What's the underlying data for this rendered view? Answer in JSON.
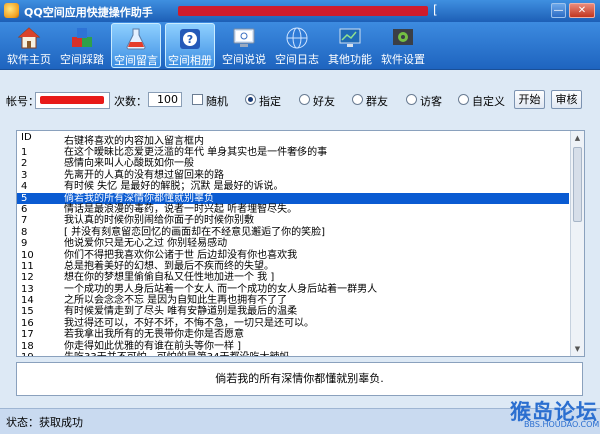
{
  "window": {
    "title": "QQ空间应用快捷操作助手",
    "title_bracket": "[",
    "title_suffix_redacted": "",
    "min_glyph": "—",
    "close_glyph": "✕"
  },
  "toolbar": [
    {
      "label": "软件主页",
      "icon": "house-icon"
    },
    {
      "label": "空间踩踏",
      "icon": "cubes-icon"
    },
    {
      "label": "空间留言",
      "icon": "flask-icon",
      "active": true
    },
    {
      "label": "空间相册",
      "icon": "help-icon",
      "active": true
    },
    {
      "label": "空间说说",
      "icon": "monitor-icon"
    },
    {
      "label": "空间日志",
      "icon": "globe-icon"
    },
    {
      "label": "其他功能",
      "icon": "desktop-icon"
    },
    {
      "label": "软件设置",
      "icon": "gear-icon"
    }
  ],
  "controls": {
    "account_label": "帐号：",
    "account_value": "",
    "times_label": "次数：",
    "times_value": "100",
    "random_label": "随机",
    "radio_specified": "指定",
    "radio_friends": "好友",
    "radio_groups": "群友",
    "radio_visitors": "访客",
    "radio_custom": "自定义",
    "start_button": "开始",
    "review_button": "审核"
  },
  "list": {
    "columns": [
      "ID",
      "右键将喜欢的内容加入留言框内"
    ],
    "selected_index": 4,
    "rows": [
      {
        "id": "1",
        "text": "在这个暧昧比恋爱更泛滥的年代  单身其实也是一件奢侈的事"
      },
      {
        "id": "2",
        "text": "感情向来叫人心酸既如你一般"
      },
      {
        "id": "3",
        "text": "先离开的人真的没有想过留回来的路"
      },
      {
        "id": "4",
        "text": "有时候 失忆 是最好的解脱；沉默 是最好的诉说。"
      },
      {
        "id": "5",
        "text": "倘若我的所有深情你都懂就别辜负"
      },
      {
        "id": "6",
        "text": "情话是最浪漫的毒药，说者一时兴起 听者埋智尽失。"
      },
      {
        "id": "7",
        "text": "我认真的时候你别闹给你面子的时候你别敷"
      },
      {
        "id": "8",
        "text": "[               并没有刻意留恋回忆的画面却在不经意见邂逅了你的笑脸]"
      },
      {
        "id": "9",
        "text": "他说爱你只是无心之过  你别轻易感动"
      },
      {
        "id": "10",
        "text": "你们不得把我喜欢你公诸于世   后边却没有你也喜欢我"
      },
      {
        "id": "11",
        "text": "总是抱着美好的幻想、到最后不疾而终的失望。"
      },
      {
        "id": "12",
        "text": "想在你的梦想里偷偷自私又任性地加进一个 我 ]"
      },
      {
        "id": "13",
        "text": "一个成功的男人身后站着一个女人  而一个成功的女人身后站着一群男人"
      },
      {
        "id": "14",
        "text": "之所以会念念不忘 是因为自知此生再也拥有不了了"
      },
      {
        "id": "15",
        "text": "有时候爱情走到了尽头 唯有安静道别是我最后的温柔"
      },
      {
        "id": "16",
        "text": "我过得还可以，不好不坏，不悔不急，一切只是还可以。"
      },
      {
        "id": "17",
        "text": "若我拿出我所有的无畏带你走你是否愿意"
      },
      {
        "id": "18",
        "text": "你走得如此优雅的有谁在前头等你一样 ]"
      },
      {
        "id": "19",
        "text": "先吃33天并不可怕，可怕的是第34天都没吃大辣蚂。"
      }
    ]
  },
  "preview_text": "倘若我的所有深情你都懂就别辜负.",
  "status_text": "状态：获取成功",
  "watermark": {
    "big": "猴岛论坛",
    "small": "BBS.HOUDAO.COM"
  }
}
